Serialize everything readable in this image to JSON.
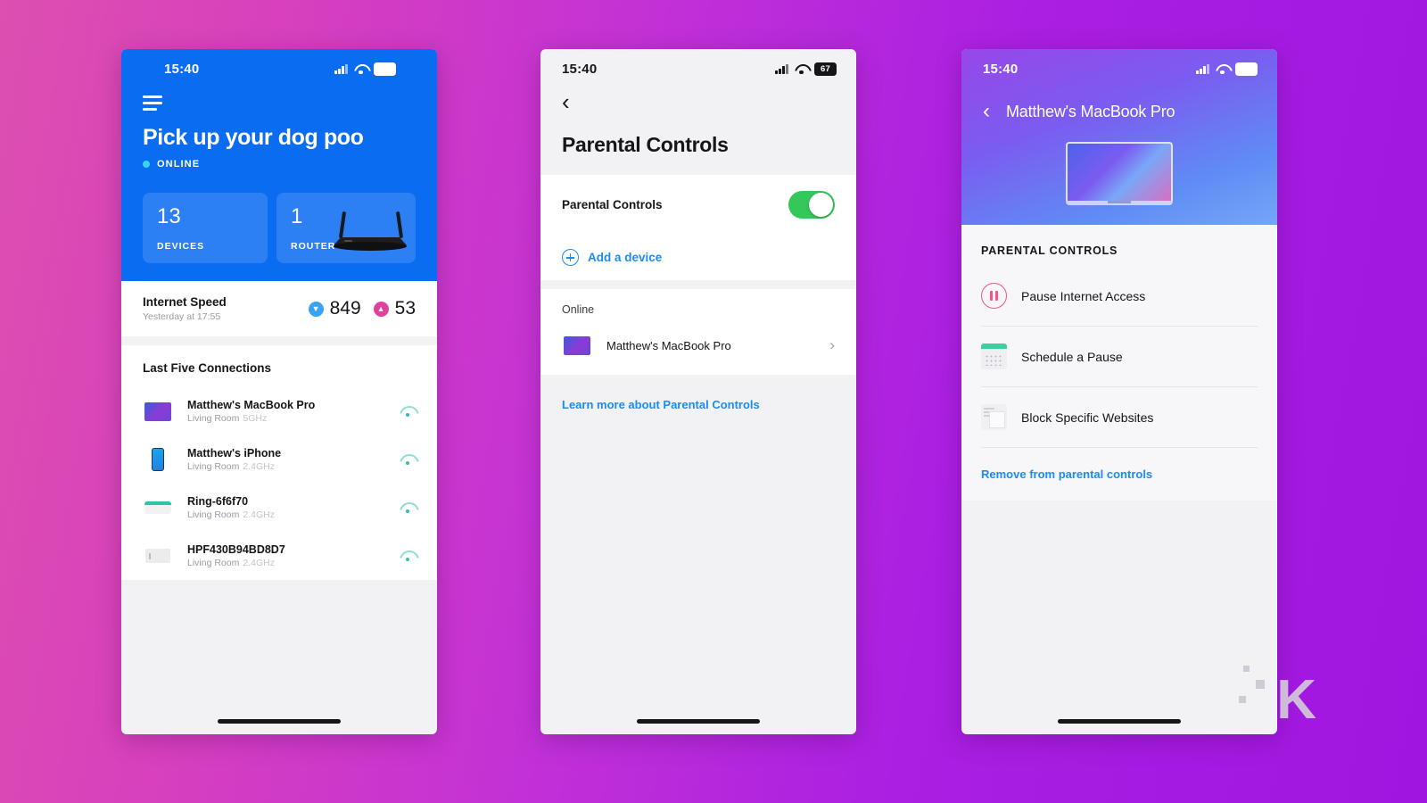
{
  "status_bar": {
    "time": "15:40",
    "battery": "67",
    "signal_icon": "cellular-bars-icon",
    "wifi_icon": "wifi-icon"
  },
  "phone1": {
    "menu_icon": "hamburger-menu-icon",
    "network_name": "Pick up your dog poo",
    "status_label": "ONLINE",
    "cards": [
      {
        "value": "13",
        "label": "DEVICES",
        "icon": ""
      },
      {
        "value": "1",
        "label": "ROUTER",
        "icon": "router-icon"
      }
    ],
    "speed": {
      "title": "Internet Speed",
      "subtitle": "Yesterday at 17:55",
      "download": "849",
      "upload": "53",
      "download_icon": "download-arrow-icon",
      "upload_icon": "upload-arrow-icon"
    },
    "connections_title": "Last Five Connections",
    "connections": [
      {
        "name": "Matthew's MacBook Pro",
        "room": "Living Room",
        "band": "5GHz",
        "icon": "laptop-icon"
      },
      {
        "name": "Matthew's iPhone",
        "room": "Living Room",
        "band": "2.4GHz",
        "icon": "smartphone-icon"
      },
      {
        "name": "Ring-6f6f70",
        "room": "Living Room",
        "band": "2.4GHz",
        "icon": "doorbell-icon"
      },
      {
        "name": "HPF430B94BD8D7",
        "room": "Living Room",
        "band": "2.4GHz",
        "icon": "printer-icon"
      }
    ]
  },
  "phone2": {
    "back_icon": "chevron-left-icon",
    "title": "Parental Controls",
    "toggle_label": "Parental Controls",
    "toggle_state": "on",
    "add_device_label": "Add a device",
    "add_device_icon": "plus-circle-icon",
    "device_group_label": "Online",
    "devices": [
      {
        "name": "Matthew's MacBook Pro",
        "icon": "laptop-icon",
        "chevron": "chevron-right-icon"
      }
    ],
    "learn_more_label": "Learn more about Parental Controls"
  },
  "phone3": {
    "back_icon": "chevron-left-icon",
    "title": "Matthew's MacBook Pro",
    "device_icon": "macbook-illustration",
    "section_label": "PARENTAL CONTROLS",
    "options": [
      {
        "label": "Pause Internet Access",
        "icon": "pause-circle-icon"
      },
      {
        "label": "Schedule a Pause",
        "icon": "calendar-icon"
      },
      {
        "label": "Block Specific Websites",
        "icon": "document-block-icon"
      }
    ],
    "remove_label": "Remove from parental controls"
  },
  "watermark": {
    "letter": "K"
  },
  "colors": {
    "primary_blue": "#0a6cf1",
    "link_blue": "#1b8cf0",
    "toggle_green": "#34c759",
    "download_blue": "#39a4f5",
    "upload_pink": "#e2409d",
    "online_cyan": "#3ad4f0",
    "background_start": "#dd4fb0",
    "background_end": "#a016e0"
  }
}
